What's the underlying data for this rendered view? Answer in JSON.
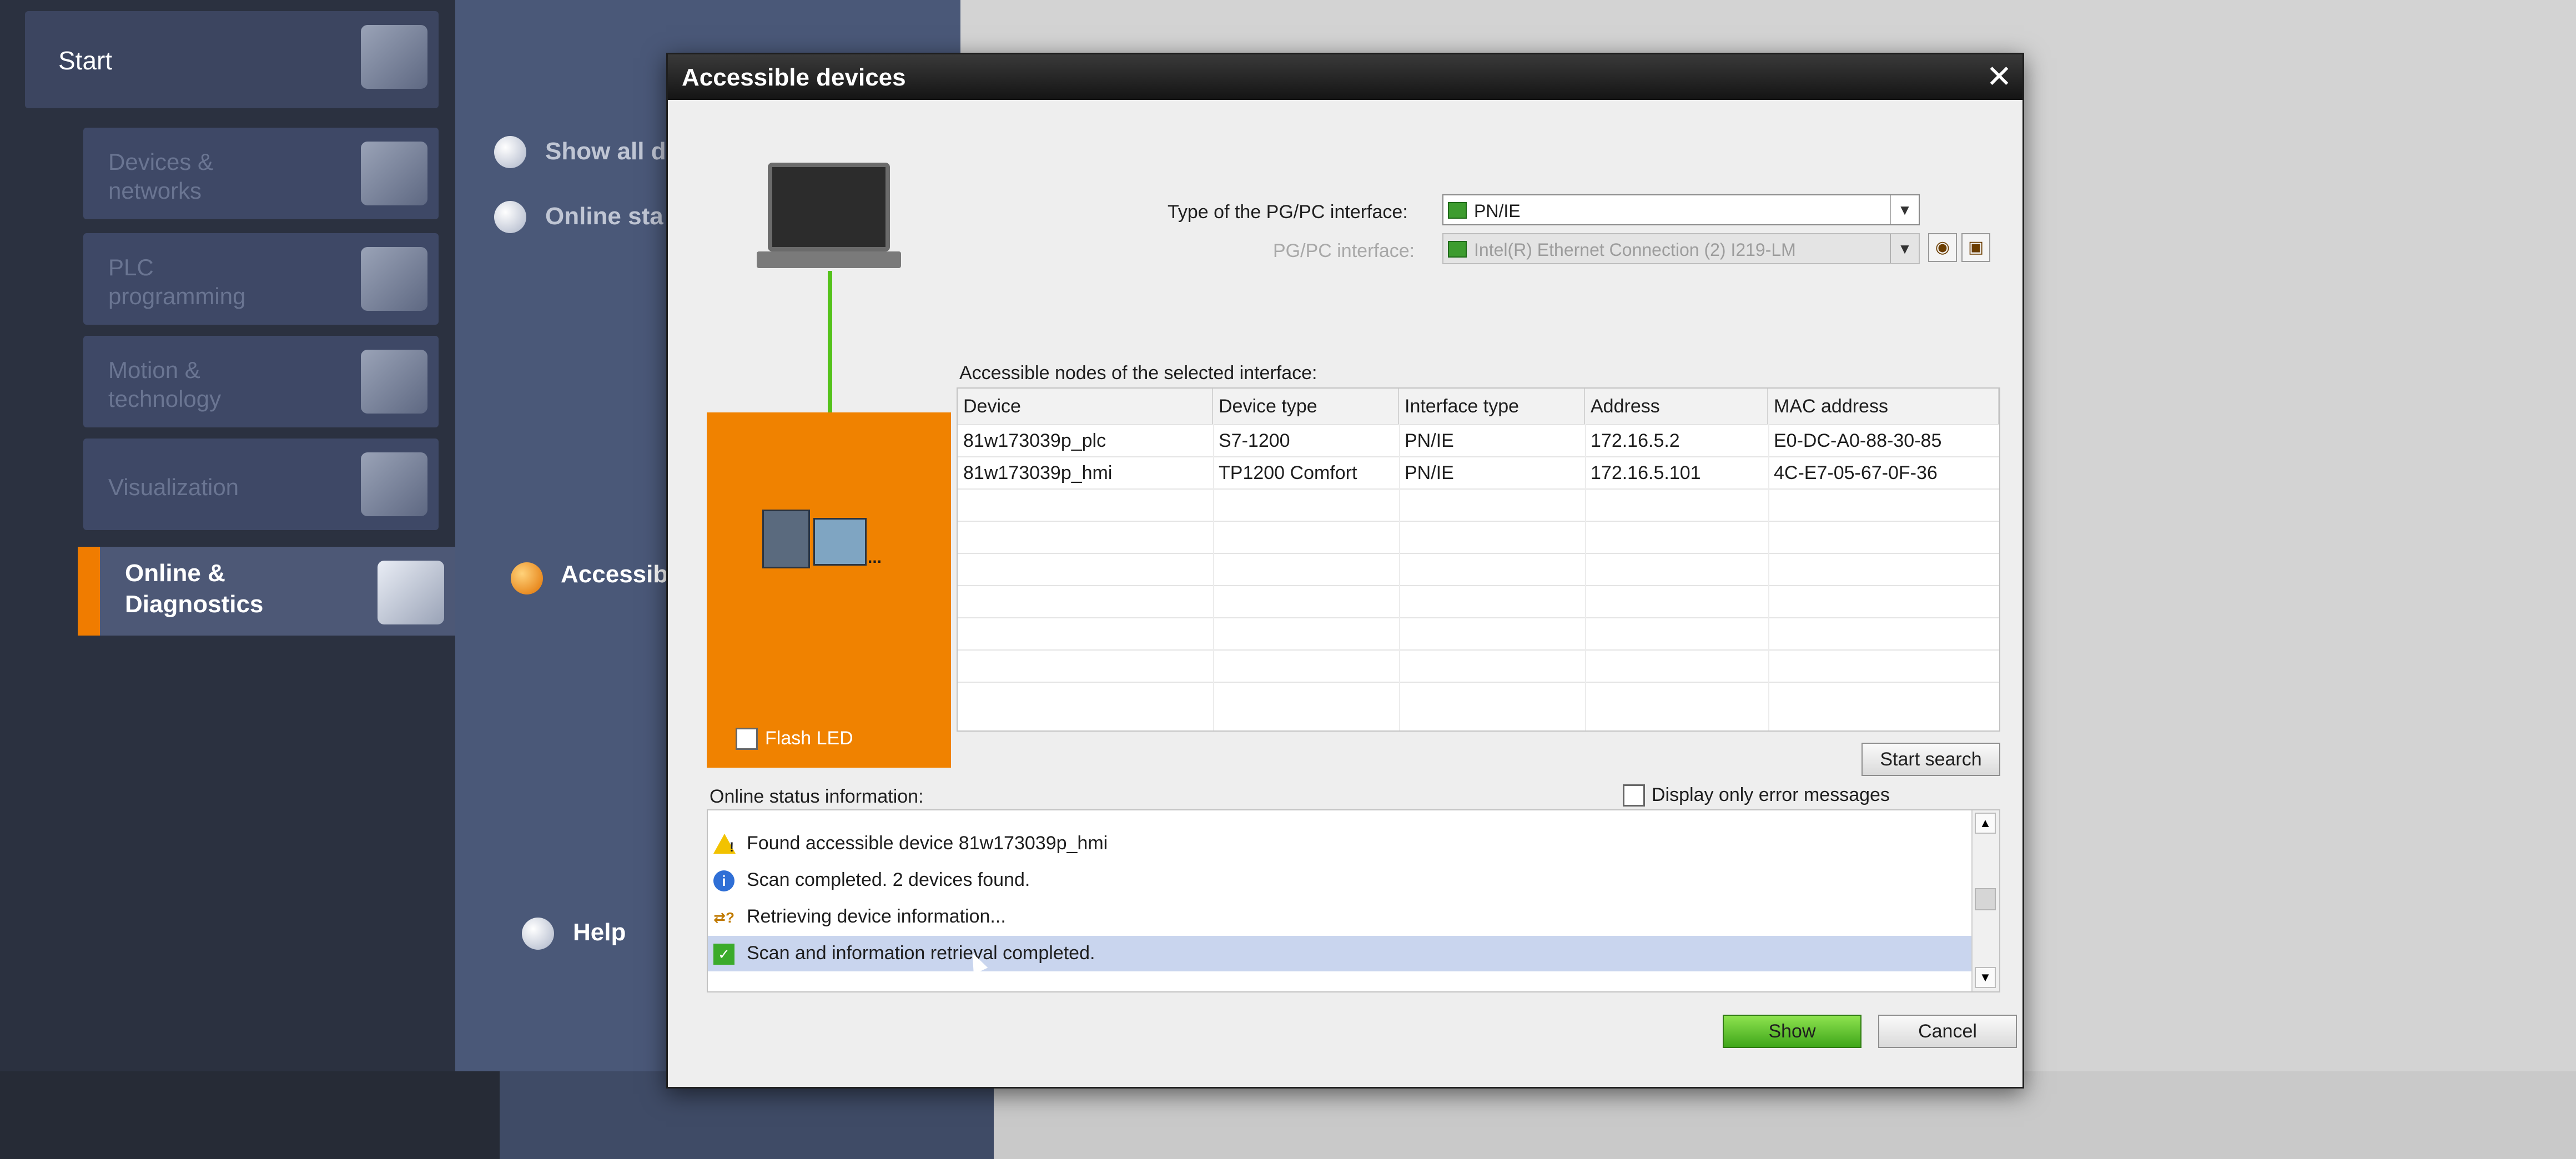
{
  "portal": {
    "start_label": "Start",
    "nav_items": [
      {
        "label": "Devices &\nnetworks"
      },
      {
        "label": "PLC\nprogramming"
      },
      {
        "label": "Motion &\ntechnology"
      },
      {
        "label": "Visualization"
      }
    ],
    "active_item": "Online &\nDiagnostics",
    "options": [
      "Show all d",
      "Online sta",
      "Accessible",
      "Help"
    ]
  },
  "dialog": {
    "title": "Accessible devices",
    "interface_type_label": "Type of the PG/PC interface:",
    "interface_type_value": "PN/IE",
    "interface_label": "PG/PC interface:",
    "interface_value": "Intel(R) Ethernet Connection (2) I219-LM",
    "nodes_label": "Accessible nodes of the selected interface:",
    "flash_led_label": "Flash LED",
    "table": {
      "columns": [
        "Device",
        "Device type",
        "Interface type",
        "Address",
        "MAC address"
      ],
      "rows": [
        [
          "81w173039p_plc",
          "S7-1200",
          "PN/IE",
          "172.16.5.2",
          "E0-DC-A0-88-30-85"
        ],
        [
          "81w173039p_hmi",
          "TP1200 Comfort",
          "PN/IE",
          "172.16.5.101",
          "4C-E7-05-67-0F-36"
        ]
      ]
    },
    "start_search_label": "Start search",
    "error_only_label": "Display only error messages",
    "status_label": "Online status information:",
    "status_messages": [
      {
        "icon": "warning-icon",
        "text": "Found accessible device 81w173039p_hmi"
      },
      {
        "icon": "info-icon",
        "text": "Scan completed. 2 devices found."
      },
      {
        "icon": "retrieving-icon",
        "text": "Retrieving device information..."
      },
      {
        "icon": "check-icon",
        "text": "Scan and information retrieval completed."
      }
    ],
    "show_label": "Show",
    "cancel_label": "Cancel"
  }
}
